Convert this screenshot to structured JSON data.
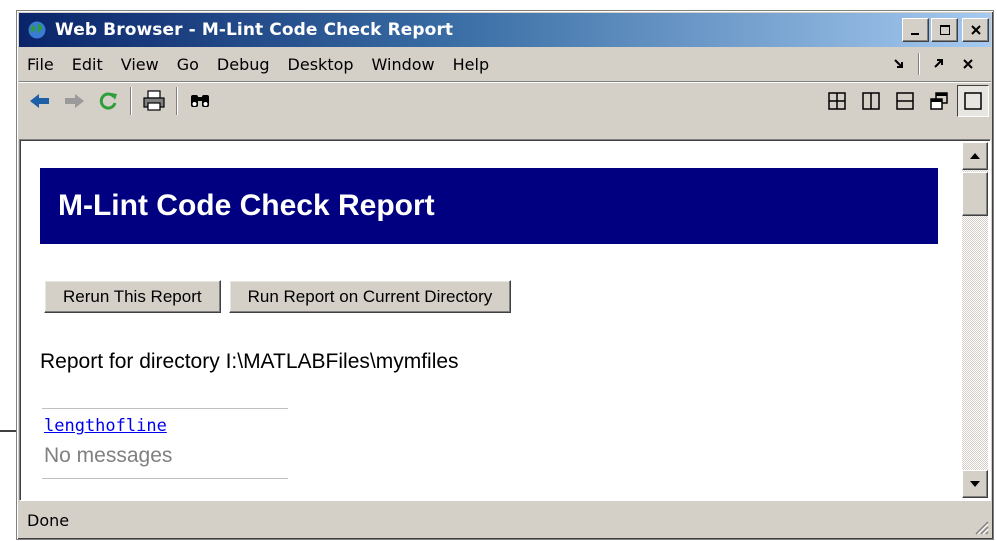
{
  "window": {
    "title": "Web Browser - M-Lint Code Check Report",
    "icon": "globe-icon"
  },
  "menu": {
    "items": [
      "File",
      "Edit",
      "View",
      "Go",
      "Debug",
      "Desktop",
      "Window",
      "Help"
    ]
  },
  "toolbar": {
    "tools": [
      "back-arrow-icon",
      "forward-arrow-icon",
      "refresh-icon",
      "print-icon",
      "find-icon"
    ],
    "layouts": [
      "tile-grid-icon",
      "tile-columns-icon",
      "tile-rows-icon",
      "float-icon",
      "maximize-icon"
    ]
  },
  "report": {
    "title": "M-Lint Code Check Report",
    "rerun_label": "Rerun This Report",
    "run_current_label": "Run Report on Current Directory",
    "directory_line": "Report for directory I:\\MATLABFiles\\mymfiles",
    "files": [
      {
        "name": "lengthofline",
        "message": "No messages"
      }
    ]
  },
  "status": {
    "text": "Done"
  },
  "colors": {
    "banner": "#000080",
    "link": "#0000ee",
    "chrome": "#d4d0c8"
  }
}
